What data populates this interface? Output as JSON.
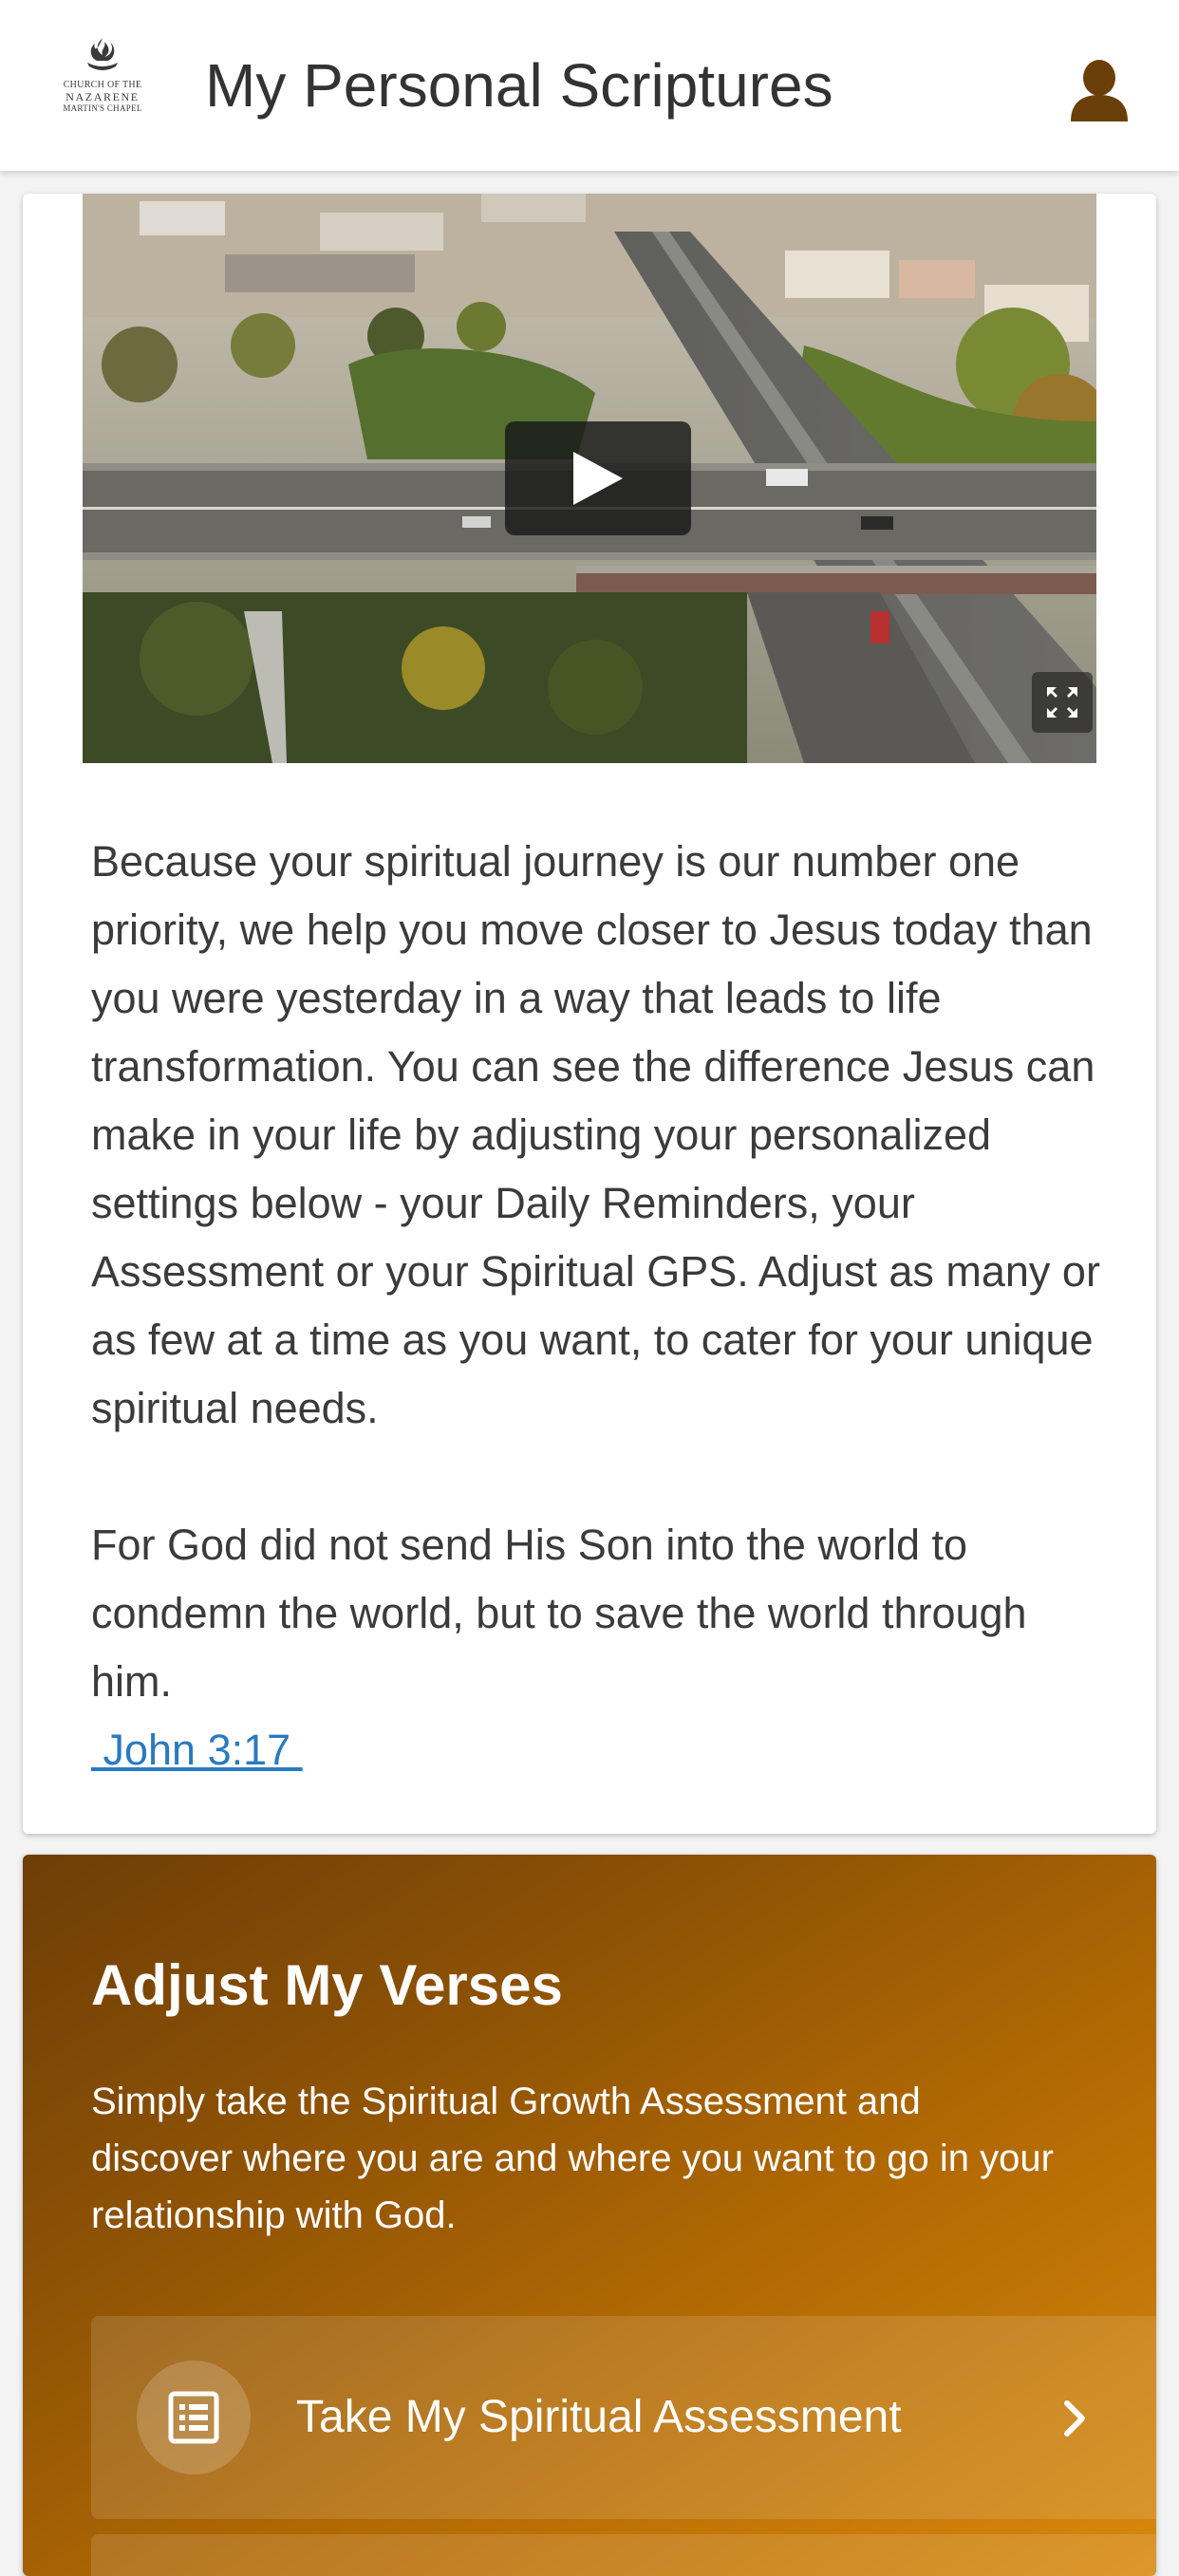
{
  "header": {
    "title": "My Personal Scriptures",
    "logo": {
      "line1": "CHURCH OF THE",
      "line2": "NAZARENE",
      "line3": "MARTIN'S CHAPEL"
    },
    "profile_icon": "user-icon"
  },
  "intro": {
    "video": {
      "play_icon": "play-icon",
      "fullscreen_icon": "fullscreen-icon"
    },
    "paragraph": "Because your spiritual journey is our number one priority, we help you move closer to Jesus today than you were yesterday in a way that leads to life transformation. You can see the difference Jesus can make in your life by adjusting your personalized settings below - your Daily Reminders, your Assessment or your Spiritual GPS. Adjust as many or as few at a time as you want, to cater for your unique spiritual needs.",
    "verse": "For God did not send His Son into the world to condemn the world, but to save the world through him.",
    "verse_ref": " John 3:17 "
  },
  "adjust": {
    "title": "Adjust My Verses",
    "description": "Simply take the Spiritual Growth Assessment and discover where you are and where you want to go in your relationship with God.",
    "assessment_button": {
      "label": "Take My Spiritual Assessment",
      "icon": "list-icon",
      "chevron": "chevron-right-icon"
    }
  },
  "colors": {
    "accent_dark": "#6e3e07",
    "accent_light": "#d8880c",
    "link": "#2a7abf",
    "profile_icon": "#6b3f0a"
  }
}
